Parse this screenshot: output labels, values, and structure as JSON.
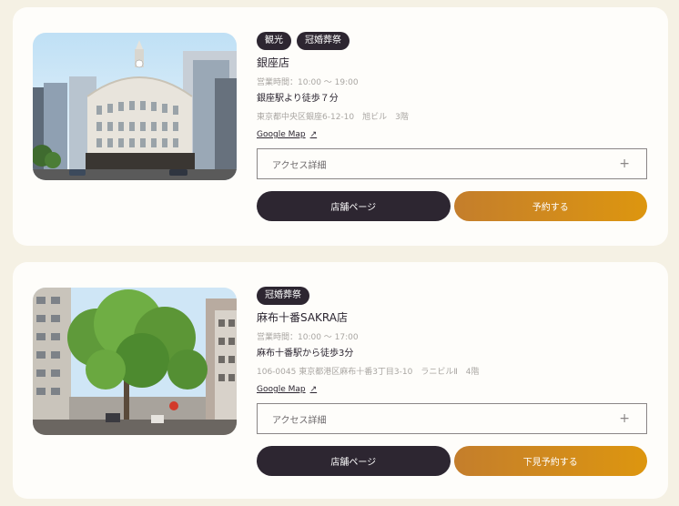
{
  "shops": [
    {
      "tags": [
        "観光",
        "冠婚葬祭"
      ],
      "name": "銀座店",
      "hours": "営業時間：10:00 ～ 19:00",
      "access": "銀座駅より徒歩７分",
      "address": "東京都中央区銀座6-12-10　旭ビル　3階",
      "map_link": "Google Map",
      "accordion_label": "アクセス詳細",
      "shop_button": "店舗ページ",
      "reserve_button": "予約する"
    },
    {
      "tags": [
        "冠婚葬祭"
      ],
      "name": "麻布十番SAKRA店",
      "hours": "営業時間：10:00 ～ 17:00",
      "access": "麻布十番駅から徒歩3分",
      "address": "106-0045 東京都港区麻布十番3丁目3-10　ラニビルⅡ　4階",
      "map_link": "Google Map",
      "accordion_label": "アクセス詳細",
      "shop_button": "店舗ページ",
      "reserve_button": "下見予約する"
    }
  ],
  "colors": {
    "page_bg": "#f5f1e4",
    "card_bg": "#fefdfa",
    "dark": "#2d2631",
    "gold_start": "#c47e2c",
    "gold_end": "#dd960f"
  },
  "icons": {
    "external_link": "↗",
    "expand": "+"
  }
}
